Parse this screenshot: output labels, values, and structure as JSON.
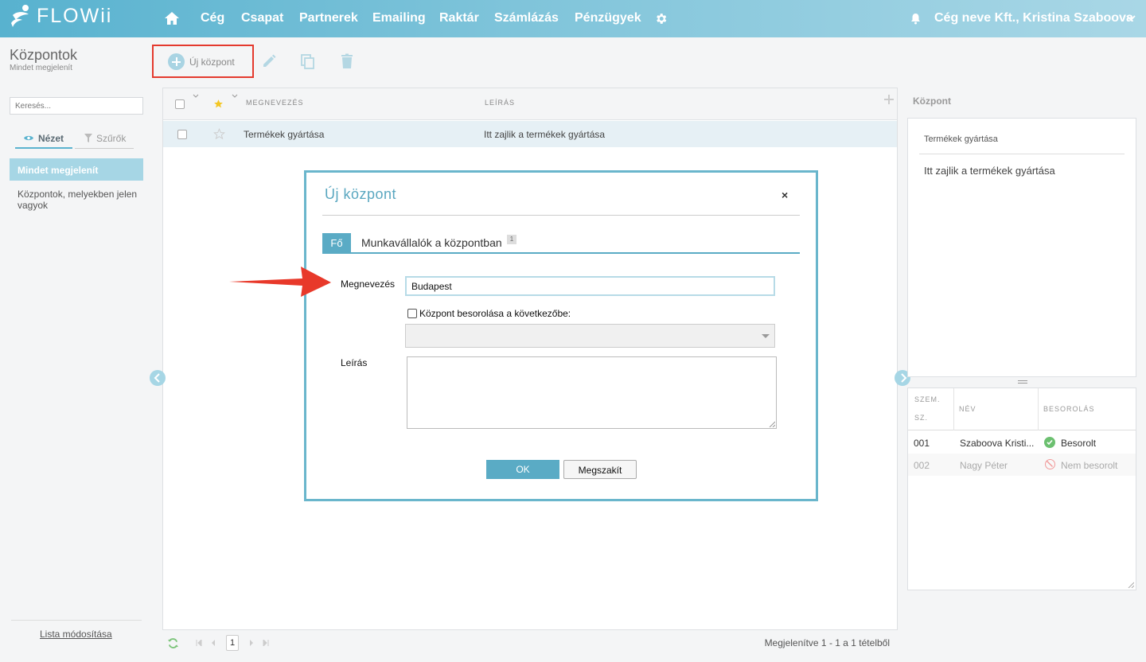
{
  "brand": {
    "name": "FLOWii",
    "accent": "#5bb3cf",
    "highlight": "#e43a2e"
  },
  "nav": {
    "items": [
      "Cég",
      "Csapat",
      "Partnerek",
      "Emailing",
      "Raktár",
      "Számlázás",
      "Pénzügyek"
    ],
    "company": "Cég neve Kft., Kristina Szaboova"
  },
  "page": {
    "title": "Központok",
    "subtitle": "Mindet megjelenít"
  },
  "toolbar": {
    "new_label": "Új központ"
  },
  "sidebar": {
    "search_placeholder": "Keresés...",
    "tab_view": "Nézet",
    "tab_filters": "Szűrők",
    "items": [
      "Mindet megjelenít",
      "Központok, melyekben jelen vagyok"
    ],
    "edit_list": "Lista módosítása"
  },
  "table": {
    "columns": [
      "MEGNEVEZÉS",
      "LEÍRÁS"
    ],
    "rows": [
      {
        "name": "Termékek gyártása",
        "description": "Itt zajlik a termékek gyártása"
      }
    ]
  },
  "pager": {
    "page": "1",
    "info": "Megjelenítve 1 - 1 a 1 tételből"
  },
  "detail": {
    "title": "Központ",
    "name": "Termékek gyártása",
    "description": "Itt zajlik a termékek gyártása",
    "columns": [
      "SZEM.",
      "SZ.",
      "NÉV",
      "BESOROLÁS"
    ],
    "rows": [
      {
        "id": "001",
        "name": "Szaboova Kristi...",
        "status": "Besorolt"
      },
      {
        "id": "002",
        "name": "Nagy Péter",
        "status": "Nem besorolt"
      }
    ]
  },
  "modal": {
    "title": "Új központ",
    "close": "×",
    "tab_main": "Fő",
    "tab_employees": "Munkavállalók a központban",
    "tab_employees_count": "1",
    "name_label": "Megnevezés",
    "name_value": "Budapest",
    "assign_label": "Központ besorolása a következőbe:",
    "description_label": "Leírás",
    "ok": "OK",
    "cancel": "Megszakít"
  }
}
